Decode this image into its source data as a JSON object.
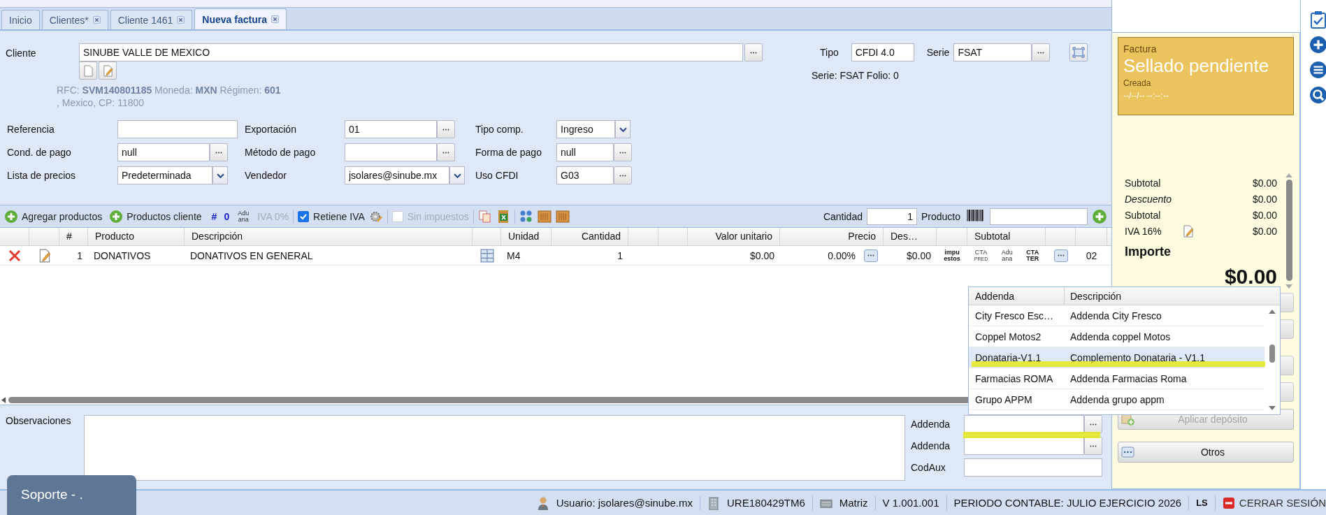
{
  "tabs": [
    {
      "label": "Inicio",
      "closable": false,
      "selected": false
    },
    {
      "label": "Clientes*",
      "closable": true,
      "selected": false
    },
    {
      "label": "Cliente 1461",
      "closable": true,
      "selected": false
    },
    {
      "label": "Nueva factura",
      "closable": true,
      "selected": true
    }
  ],
  "client": {
    "label": "Cliente",
    "value": "SINUBE VALLE DE MEXICO",
    "info_line1": "RFC: **SVM140801185** Moneda: **MXN** Régimen: **601**",
    "info_line2": ", Mexico, CP: 11800"
  },
  "tipo": {
    "label": "Tipo",
    "value": "CFDI 4.0"
  },
  "serie": {
    "label": "Serie",
    "value": "FSAT"
  },
  "folio": "Serie: FSAT Folio: 0",
  "form_rows": [
    [
      {
        "label": "Referencia",
        "kind": "text"
      },
      {
        "label": "Exportación",
        "value": "01",
        "kind": "picker"
      },
      {
        "label": "Tipo comp.",
        "value": "Ingreso",
        "kind": "select"
      }
    ],
    [
      {
        "label": "Cond. de pago",
        "value": "null",
        "kind": "picker"
      },
      {
        "label": "Método de pago",
        "kind": "picker"
      },
      {
        "label": "Forma de pago",
        "value": "null",
        "kind": "picker"
      }
    ],
    [
      {
        "label": "Lista de precios",
        "value": "Predeterminada",
        "kind": "select"
      },
      {
        "label": "Vendedor",
        "value": "jsolares@sinube.mx",
        "kind": "select"
      },
      {
        "label": "Uso CFDI",
        "value": "G03",
        "kind": "picker"
      }
    ]
  ],
  "toolbar": {
    "add_products": "Agregar productos",
    "client_products": "Productos cliente",
    "hash": "#",
    "count": "0",
    "customs_icon": [
      "Adu",
      "ana"
    ],
    "iva0": "IVA 0%",
    "retiene_iva": {
      "label": "Retiene IVA",
      "checked": true,
      "disabled": false
    },
    "sin_impuestos": {
      "label": "Sin impuestos",
      "checked": false,
      "disabled": true
    },
    "quantity_label": "Cantidad",
    "quantity": "1",
    "product_label": "Producto"
  },
  "table": {
    "columns": [
      "",
      "",
      "#",
      "Producto",
      "Descripción",
      "",
      "Unidad",
      "Cantidad",
      "",
      "",
      "Valor unitario",
      "Precio",
      "Des…",
      "",
      "Subtotal",
      "",
      ""
    ],
    "rows": [
      {
        "number": "1",
        "product": "DONATIVOS",
        "description": "DONATIVOS EN GENERAL",
        "unit": "M4",
        "quantity": "1",
        "unit_value": "$0.00",
        "percent": "0.00%",
        "discount": "$0.00",
        "taxes_icon": [
          "impu",
          "estos"
        ],
        "cta_pred_icon": [
          "CTA",
          "PRED"
        ],
        "customs_icon": [
          "Adu",
          "ana"
        ],
        "cta_ter_icon": [
          "CTA",
          "TER"
        ],
        "code": "02"
      }
    ]
  },
  "observations_label": "Observaciones",
  "addenda_fields": [
    {
      "label": "Addenda",
      "kind": "picker"
    },
    {
      "label": "Addenda",
      "kind": "picker"
    },
    {
      "label": "CodAux",
      "kind": "text"
    }
  ],
  "status_card": {
    "type": "Factura",
    "status": "Sellado pendiente",
    "state": "Creada",
    "date": "--/--/-- --:--:--"
  },
  "totals": [
    {
      "label": "Subtotal",
      "value": "$0.00",
      "italic": false,
      "edit": false
    },
    {
      "label": "Descuento",
      "value": "$0.00",
      "italic": true,
      "edit": false
    },
    {
      "label": "Subtotal",
      "value": "$0.00",
      "italic": false,
      "edit": false
    },
    {
      "label": "IVA 16%",
      "value": "$0.00",
      "italic": false,
      "edit": true
    }
  ],
  "importe_label": "Importe",
  "importe": "$0.00",
  "panel_buttons": [
    {
      "label": "Aplicar depósito",
      "disabled": true
    },
    {
      "label": "Otros",
      "disabled": false
    }
  ],
  "addenda_dropdown": {
    "columns": [
      "Addenda",
      "Descripción"
    ],
    "rows": [
      {
        "name": "City Fresco Esc…",
        "description": "Addenda City Fresco",
        "selected": false
      },
      {
        "name": "Coppel Motos2",
        "description": "Addenda coppel Motos",
        "selected": false
      },
      {
        "name": "Donataria-V1.1",
        "description": "Complemento Donataria - V1.1",
        "selected": true
      },
      {
        "name": "Farmacias ROMA",
        "description": "Addenda Farmacias Roma",
        "selected": false
      },
      {
        "name": "Grupo APPM",
        "description": "Addenda grupo appm",
        "selected": false
      }
    ]
  },
  "support_tab": "Soporte - .",
  "status_bar": {
    "user": "Usuario: jsolares@sinube.mx",
    "rfc": "URE180429TM6",
    "branch": "Matriz",
    "version": "V 1.001.001",
    "period": "PERIODO CONTABLE: JULIO EJERCICIO 2026",
    "initials": "LS",
    "logout": "CERRAR SESIÓN"
  }
}
